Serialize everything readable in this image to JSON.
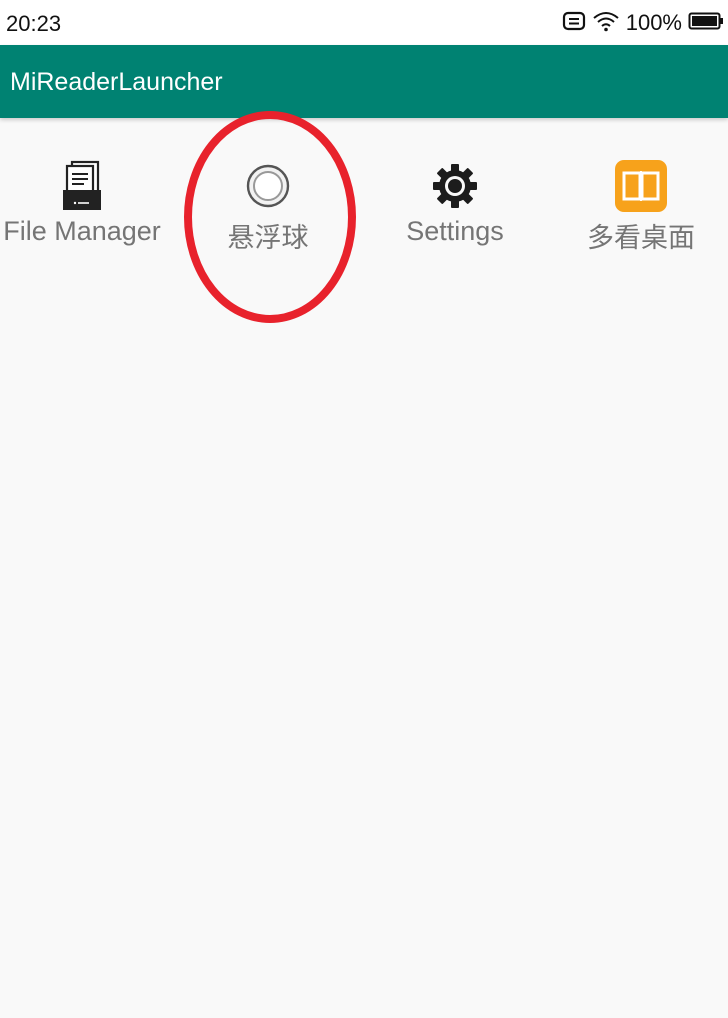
{
  "status_bar": {
    "time": "20:23",
    "battery": "100%",
    "icons": [
      "message-icon",
      "wifi-icon",
      "battery-icon"
    ]
  },
  "app_bar": {
    "title": "MiReaderLauncher",
    "color": "#008272"
  },
  "apps": [
    {
      "label": "File Manager",
      "icon": "file-manager-icon"
    },
    {
      "label": "悬浮球",
      "icon": "floating-ball-icon"
    },
    {
      "label": "Settings",
      "icon": "gear-icon"
    },
    {
      "label": "多看桌面",
      "icon": "book-icon"
    }
  ],
  "colors": {
    "background": "#f9f9f9",
    "label": "#757575",
    "annotation": "#e8222c",
    "book_icon": "#f7a21b"
  }
}
